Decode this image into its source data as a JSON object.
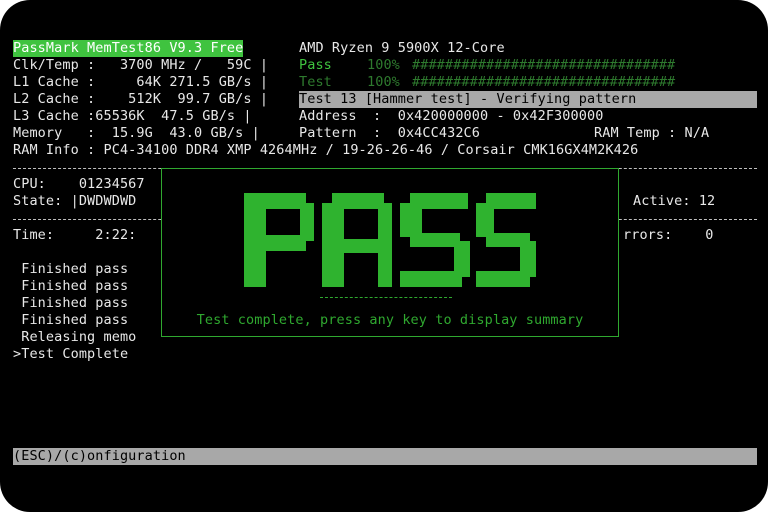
{
  "header": {
    "app_title": "PassMark MemTest86 V9.3 Free",
    "cpu_model": "AMD Ryzen 9 5900X 12-Core"
  },
  "system": {
    "clk_temp": "Clk/Temp :   3700 MHz /   59C |",
    "l1": "L1 Cache :     64K 271.5 GB/s |",
    "l2": "L2 Cache :    512K  99.7 GB/s |",
    "l3": "L3 Cache :65536K  47.5 GB/s |",
    "memory": "Memory   :  15.9G  43.0 GB/s |",
    "ram_info": "RAM Info : PC4-34100 DDR4 XMP 4264MHz / 19-26-26-46 / Corsair CMK16GX4M2K426"
  },
  "progress": {
    "pass_label": "Pass",
    "pass_percent": "100%",
    "pass_value": 100,
    "test_label": "Test",
    "test_percent": "100%",
    "test_value": 100,
    "bar_text": "################################"
  },
  "test": {
    "current": "Test 13 [Hammer test] - Verifying pattern",
    "address": "Address  :  0x420000000 - 0x42F300000",
    "pattern": "Pattern  :  0x4CC432C6",
    "ram_temp": "RAM Temp : N/A"
  },
  "status": {
    "cpu": "CPU:    01234567",
    "state": "State: |DWDWDWD",
    "active": "Active: 12",
    "time": "Time:     2:22:",
    "errors": "rrors:    0"
  },
  "log": [
    " Finished pass",
    " Finished pass",
    " Finished pass",
    " Finished pass",
    " Releasing memo",
    ">Test Complete"
  ],
  "popup": {
    "result_text": "PASS",
    "rule": "--------------",
    "message": "Test complete, press any key to display summary"
  },
  "footer": {
    "hint": "(ESC)/(c)onfiguration"
  },
  "colors": {
    "background": "#000000",
    "accent_green": "#3fc33f",
    "dim_green": "#2e7a2e",
    "bar_gray": "#a8a8a8",
    "text": "#e8e8e8"
  }
}
